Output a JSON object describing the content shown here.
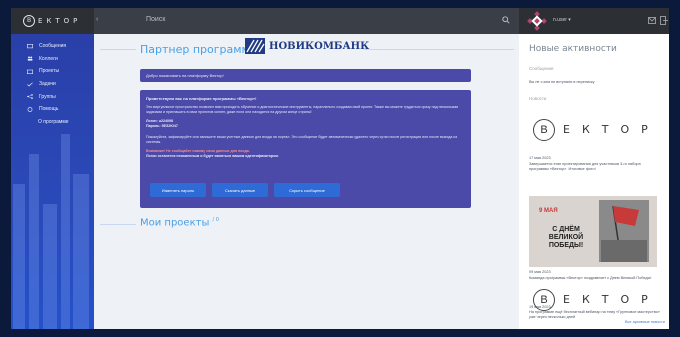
{
  "header": {
    "logo_text": "ЕКТОР",
    "logo_letter": "В",
    "search_placeholder": "Поиск",
    "user_name": "n.user ▾"
  },
  "sidebar": {
    "items": [
      {
        "label": "Сообщения",
        "icon": "message-icon"
      },
      {
        "label": "Коллеги",
        "icon": "people-icon"
      },
      {
        "label": "Проекты",
        "icon": "folder-icon"
      },
      {
        "label": "Задачи",
        "icon": "tasks-icon"
      },
      {
        "label": "Группы",
        "icon": "share-icon"
      },
      {
        "label": "Помощь",
        "icon": "help-icon"
      },
      {
        "label": "О программе",
        "icon": ""
      }
    ]
  },
  "main": {
    "partner_title": "Партнер программы:",
    "bank_name": "НОВИКОМБАНК",
    "welcome": "Добро пожаловать на платформу Вектор!",
    "card": {
      "heading": "Приветствуем вас на платформе программы «Вектор»!",
      "intro": "Это виртуальное пространство позволит вам проходить обучение и диагностические инструменты, параллельно создавая свой проект. Также вы можете трудиться сразу над нескольким задачами и приглашать в свои проектов коллег, даже если они находятся на другом конце страны!",
      "login": "Логин: u224098",
      "password": "Пароль: 5ЕЗ2Ю47",
      "note": "Пожалуйста, зафиксируйте или запишите ваши учетные данные для входа на портал. Это сообщение будет автоматически удалено через сутки после регистрации или после выхода из системы.",
      "warning": "Внимание! Не сообщайте никому свои данные для входа.",
      "note2": "Логин останется неизменным и будет являться вашим идентификатором."
    },
    "buttons": [
      "Изменить пароль",
      "Скачать данные",
      "Скрыть сообщение"
    ],
    "projects_title": "Мои проекты",
    "projects_count": "/ 0"
  },
  "right": {
    "title": "Новые активности",
    "messages_label": "Сообщения",
    "messages_empty": "Вы не с кем не вступали в переписку",
    "news_label": "Новости",
    "news": [
      {
        "date": "17 мая 2023",
        "text": "Завершается этап проектирования для участников 3-го набора программы «Вектор». Итоговое фото!"
      },
      {
        "date": "09 мая 2023",
        "text": "Команда программы «Вектор» поздравляет с Днем Великой Победы!"
      },
      {
        "date": "19 мая 2023",
        "text": "На программе ещё бесплатный вебинар на тему «Групповое мастерство» уже через несколько дней"
      }
    ],
    "poster_may": "9 МАЯ",
    "poster_text": "С ДНЁМ ВЕЛИКОЙ ПОБЕДЫ!",
    "all_news": "Все архивные новости"
  }
}
